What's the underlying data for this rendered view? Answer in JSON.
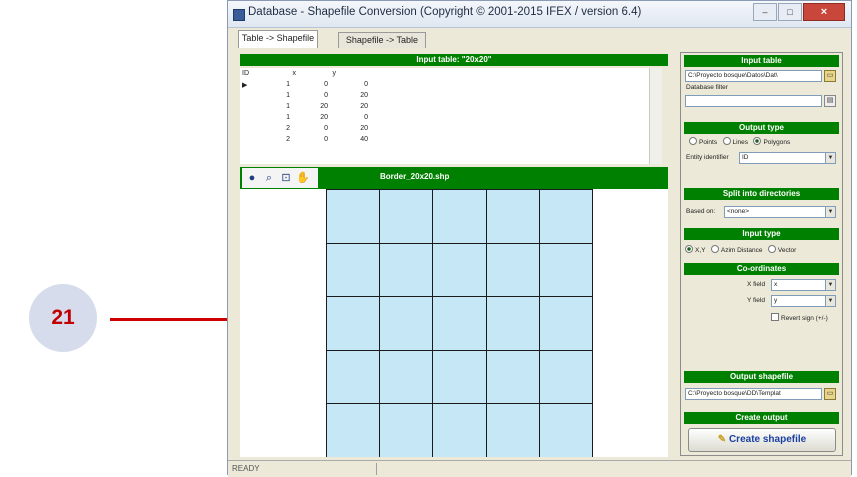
{
  "callout": {
    "number": "21"
  },
  "window": {
    "title": "Database - Shapefile Conversion (Copyright © 2001-2015 IFEX / version 6.4)",
    "close_label": "×"
  },
  "tabs": [
    {
      "label": "Table -> Shapefile",
      "active": true
    },
    {
      "label": "Shapefile -> Table",
      "active": false
    }
  ],
  "input_table_header": "Input table: \"20x20\"",
  "table": {
    "headers": [
      "ID",
      "x",
      "y"
    ],
    "rows": [
      [
        "1",
        "0",
        "0"
      ],
      [
        "1",
        "0",
        "20"
      ],
      [
        "1",
        "20",
        "20"
      ],
      [
        "1",
        "20",
        "0"
      ],
      [
        "2",
        "0",
        "20"
      ],
      [
        "2",
        "0",
        "40"
      ]
    ]
  },
  "map": {
    "filename": "Border_20x20.shp",
    "tools": [
      "globe-icon",
      "zoom-in-icon",
      "zoom-extent-icon",
      "pan-icon"
    ]
  },
  "right_panel": {
    "input_table_title": "Input table",
    "input_path": "C:\\Proyecto bosque\\Datos\\Dat\\",
    "db_filter_label": "Database filter",
    "output_type_title": "Output type",
    "output_types": [
      "Points",
      "Lines",
      "Polygons"
    ],
    "output_type_selected": "Polygons",
    "entity_identifier_label": "Entity identifier",
    "entity_identifier_value": "ID",
    "split_title": "Split into directories",
    "based_on_label": "Based on:",
    "based_on_value": "<none>",
    "input_type_title": "Input type",
    "input_types": [
      "X,Y",
      "Azim Distance",
      "Vector"
    ],
    "input_type_selected": "X,Y",
    "coords_title": "Co-ordinates",
    "xfield_label": "X field",
    "xfield_value": "x",
    "yfield_label": "Y field",
    "yfield_value": "y",
    "revert_sign_label": "Revert sign (+/-)",
    "output_shapefile_title": "Output shapefile",
    "output_path": "C:\\Proyecto bosque\\DD\\Templat",
    "create_output_title": "Create output",
    "create_button": "Create shapefile"
  },
  "status": {
    "text": "READY"
  },
  "colors": {
    "green_header": "#008000",
    "grid_fill": "#c6e8f6",
    "callout_red": "#d00000"
  }
}
